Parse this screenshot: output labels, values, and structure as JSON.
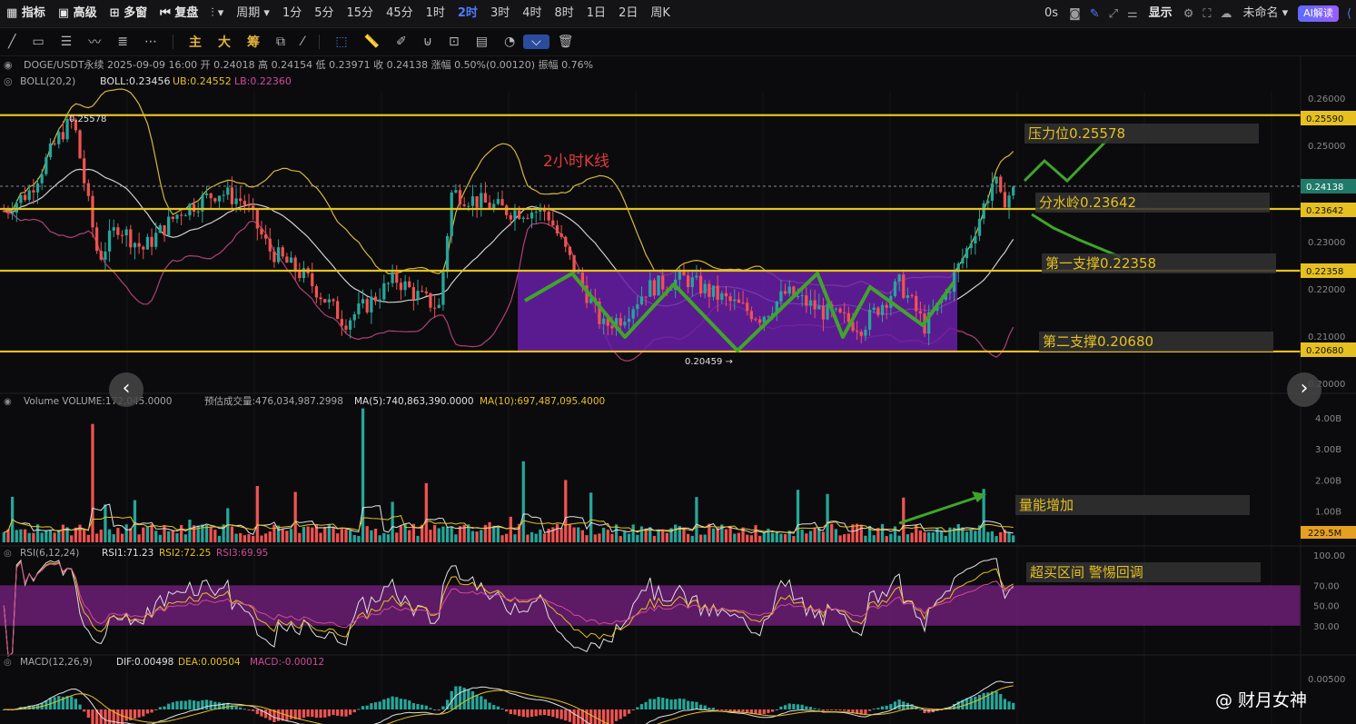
{
  "topbar": {
    "left_items": [
      "指标",
      "高级",
      "多窗",
      "复盘",
      "周期"
    ],
    "timeframes": [
      "1分",
      "5分",
      "15分",
      "45分",
      "1时",
      "2时",
      "3时",
      "4时",
      "8时",
      "1日",
      "2日",
      "周K"
    ],
    "active_timeframe": "2时",
    "right_items": {
      "countdown": "0s",
      "display": "显示",
      "account": "未命名",
      "ai": "AI解读"
    }
  },
  "drawing_toolbar": {
    "labels": [
      "主",
      "大",
      "筹"
    ]
  },
  "header": {
    "line1": "DOGE/USDT永续  2025-09-09 16:00  开 0.24018  高 0.24154  低 0.23971  收 0.24138  涨幅 0.50%(0.00120)  振幅 0.76%",
    "boll_name": "BOLL(20,2)",
    "boll_mid": "BOLL:0.23456",
    "boll_ub": "UB:0.24552",
    "boll_lb": "LB:0.22360"
  },
  "price_panel": {
    "title": "2小时K线",
    "high_label": "0.25578",
    "low_label": "0.20459 →",
    "levels": [
      {
        "text": "压力位0.25578",
        "axis": "0.25590",
        "price": 0.2559
      },
      {
        "text": "分水岭0.23642",
        "axis": "0.23642",
        "price": 0.23642
      },
      {
        "text": "第一支撑0.22358",
        "axis": "0.22358",
        "price": 0.22358
      },
      {
        "text": "第二支撑0.20680",
        "axis": "0.20680",
        "price": 0.2068
      }
    ],
    "current_price": "0.24138",
    "axis_ticks": [
      "0.26000",
      "0.25000",
      "0.23000",
      "0.22000",
      "0.21000",
      "0.20000"
    ],
    "range_box": {
      "from_bar": 0.38,
      "to_bar": 0.705,
      "top": 0.2236,
      "bottom": 0.2068
    }
  },
  "volume_panel": {
    "header": "Volume  VOLUME:172,045.0000  预估成交量:476,034,987.2998  MA(5):740,863,390.0000  MA(10):697,487,095.4000",
    "header_main": "Volume  VOLUME:172,045.0000",
    "header_est": "预估成交量:476,034,987.2998",
    "header_ma5": "MA(5):740,863,390.0000",
    "header_ma10": "MA(10):697,487,095.4000",
    "annotation": "量能增加",
    "axis_ticks": [
      "4.00B",
      "3.00B",
      "2.00B",
      "1.00B"
    ],
    "current": "229.5M"
  },
  "rsi_panel": {
    "header_name": "RSI(6,12,24)",
    "rsi1": "RSI1:71.23",
    "rsi2": "RSI2:72.25",
    "rsi3": "RSI3:69.95",
    "annotation": "超买区间 警惕回调",
    "axis_ticks": [
      "100.00",
      "70.00",
      "50.00",
      "30.00"
    ]
  },
  "macd_panel": {
    "header_name": "MACD(12,26,9)",
    "dif": "DIF:0.00498",
    "dea": "DEA:0.00504",
    "macd": "MACD:-0.00012",
    "axis_ticks": [
      "0.00500"
    ]
  },
  "watermark": "@ 财月女神",
  "colors": {
    "up": "#26a69a",
    "down": "#ef5350",
    "gold": "#e6c020",
    "green_path": "#3fa52a",
    "box": "#6a1fa8",
    "rsi_band": "#6b1f74"
  }
}
